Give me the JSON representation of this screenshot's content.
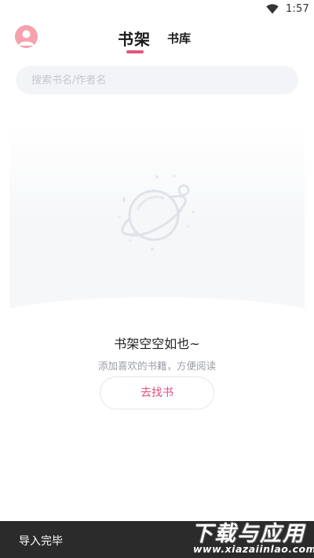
{
  "status_bar": {
    "time": "1:57",
    "icons": [
      "wifi-icon"
    ]
  },
  "header": {
    "avatar_icon": "avatar-icon",
    "tabs": [
      {
        "label": "书架",
        "active": true
      },
      {
        "label": "书库",
        "active": false
      }
    ]
  },
  "search": {
    "placeholder": "搜索书名/作者名"
  },
  "empty_state": {
    "icon": "planet-icon",
    "title": "书架空空如也~",
    "subtitle": "添加喜欢的书籍，方便阅读",
    "button_label": "去找书"
  },
  "toast": {
    "text": "导入完毕"
  },
  "watermark": {
    "title": "下载与应用",
    "url": "www.xiazaiinlao.com"
  },
  "colors": {
    "accent": "#e2567a",
    "search_bg": "#f3f4f7",
    "toast_bg": "#2b2b2b",
    "avatar": "#f4a2ad"
  }
}
